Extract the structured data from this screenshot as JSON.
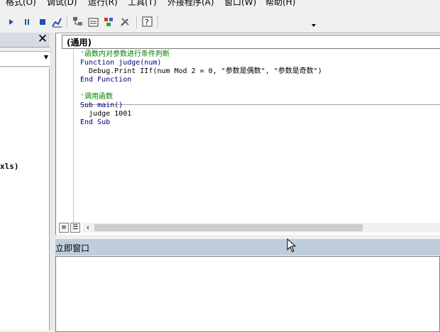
{
  "menubar": {
    "items": [
      "格式(O)",
      "调试(D)",
      "运行(R)",
      "工具(T)",
      "外接程序(A)",
      "窗口(W)",
      "帮助(H)"
    ]
  },
  "toolbar": {
    "icons": [
      "run-icon",
      "pause-icon",
      "stop-icon",
      "design-mode-icon",
      "project-explorer-icon",
      "properties-icon",
      "object-browser-icon",
      "toolbox-icon",
      "help-icon",
      "toolbar-options-icon"
    ]
  },
  "code_window": {
    "object_combo": "(通用)",
    "lines": [
      {
        "text": "'函数内对参数进行条件判断",
        "kind": "cmt"
      },
      {
        "text": "Function judge(num)",
        "kind": "kw"
      },
      {
        "text": "  Debug.Print IIf(num Mod 2 = 0, \"参数是偶数\", \"参数是奇数\")",
        "kind": "txt"
      },
      {
        "text": "End Function",
        "kind": "kw"
      },
      {
        "text": "'调用函数",
        "kind": "cmt"
      },
      {
        "text": "Sub main()",
        "kind": "kw"
      },
      {
        "text": "  judge 1001",
        "kind": "txt"
      },
      {
        "text": "End Sub",
        "kind": "kw"
      }
    ]
  },
  "left_panel": {
    "visible_text": "xls)"
  },
  "immediate_window": {
    "title": "立即窗口",
    "content": ""
  },
  "colors": {
    "comment": "#008000",
    "keyword": "#00007a",
    "title_bar": "#bfcddb"
  }
}
